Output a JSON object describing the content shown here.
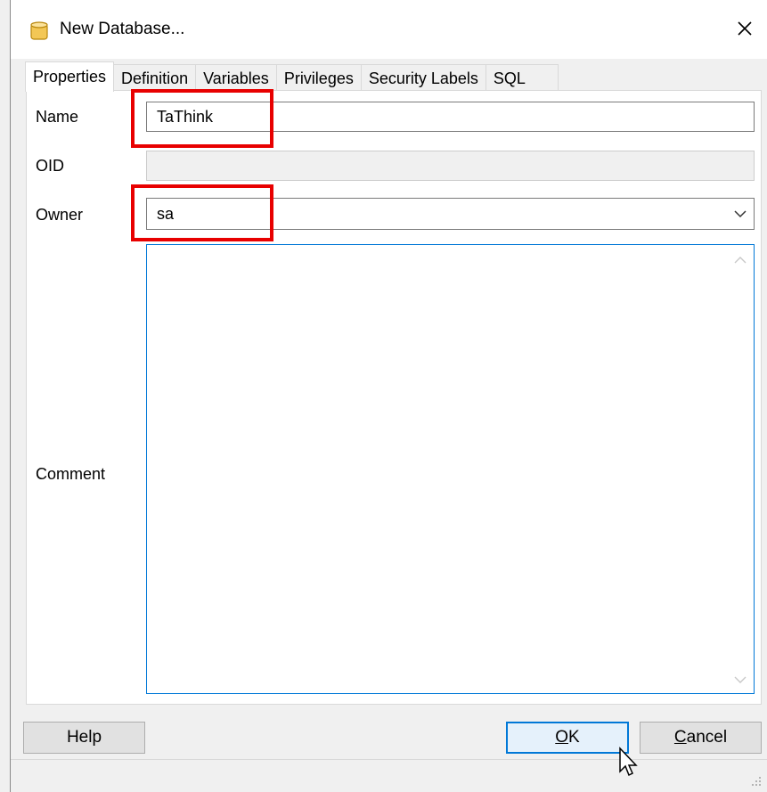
{
  "window": {
    "title": "New Database...",
    "close_glyph": "✕"
  },
  "tabs": [
    {
      "label": "Properties",
      "active": true
    },
    {
      "label": "Definition",
      "active": false
    },
    {
      "label": "Variables",
      "active": false
    },
    {
      "label": "Privileges",
      "active": false
    },
    {
      "label": "Security Labels",
      "active": false
    },
    {
      "label": "SQL",
      "active": false
    }
  ],
  "form": {
    "name_label": "Name",
    "name_value": "TaThink",
    "oid_label": "OID",
    "oid_value": "",
    "owner_label": "Owner",
    "owner_value": "sa",
    "comment_label": "Comment",
    "comment_value": ""
  },
  "buttons": {
    "help": "Help",
    "ok_mnemonic": "O",
    "ok_rest": "K",
    "cancel_mnemonic": "C",
    "cancel_rest": "ancel"
  },
  "colors": {
    "highlight": "#e80000",
    "focus": "#0078d7"
  },
  "icons": {
    "title": "database-icon",
    "close": "close-icon",
    "dropdown": "chevron-down-icon"
  }
}
